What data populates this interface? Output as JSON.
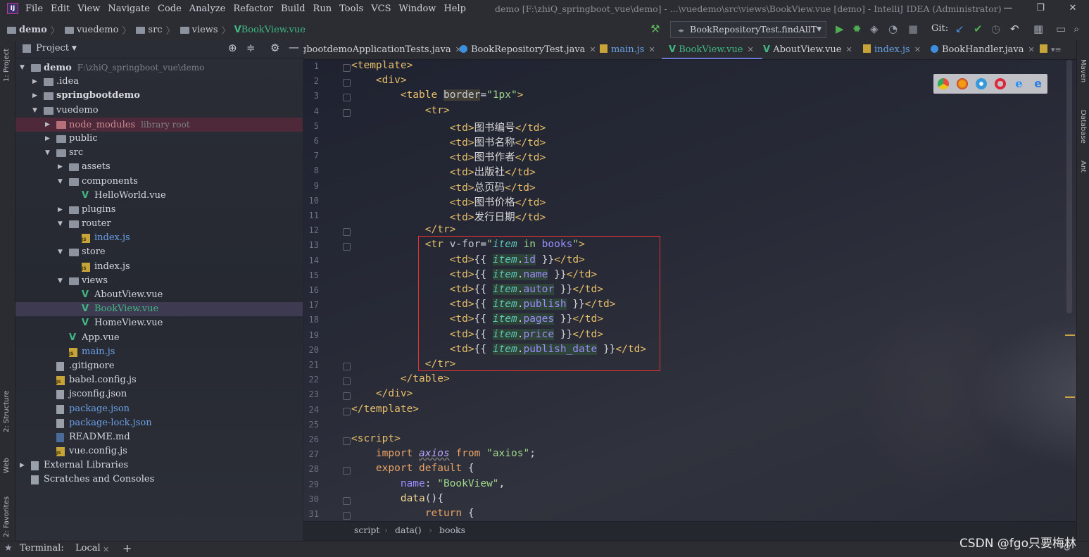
{
  "menubar": {
    "app_icon": "intellij-icon",
    "items": [
      "File",
      "Edit",
      "View",
      "Navigate",
      "Code",
      "Analyze",
      "Refactor",
      "Build",
      "Run",
      "Tools",
      "VCS",
      "Window",
      "Help"
    ],
    "title": "demo [F:\\zhiQ_springboot_vue\\demo] - ...\\vuedemo\\src\\views\\BookView.vue [demo] - IntelliJ IDEA (Administrator)",
    "minimize": "—",
    "restore": "❐",
    "close": "✕"
  },
  "breadcrumbs": [
    "demo",
    "vuedemo",
    "src",
    "views",
    "BookView.vue"
  ],
  "toolbar": {
    "run_config": "BookRepositoryTest.findAllT",
    "git_label": "Git:"
  },
  "project_panel": {
    "title": "Project",
    "tree": [
      {
        "label": "demo",
        "hint": "F:\\zhiQ_springboot_vue\\demo",
        "depth": 0,
        "icon": "folder-module",
        "open": true,
        "bold": true
      },
      {
        "label": ".idea",
        "depth": 1,
        "icon": "folder",
        "open": false
      },
      {
        "label": "springbootdemo",
        "depth": 1,
        "icon": "folder-module",
        "open": false,
        "bold": true
      },
      {
        "label": "vuedemo",
        "depth": 1,
        "icon": "folder-module",
        "open": true
      },
      {
        "label": "node_modules",
        "hint": "library root",
        "depth": 2,
        "icon": "folder-excluded",
        "open": false,
        "excluded": true
      },
      {
        "label": "public",
        "depth": 2,
        "icon": "folder",
        "open": false
      },
      {
        "label": "src",
        "depth": 2,
        "icon": "folder",
        "open": true
      },
      {
        "label": "assets",
        "depth": 3,
        "icon": "folder",
        "open": false
      },
      {
        "label": "components",
        "depth": 3,
        "icon": "folder",
        "open": true
      },
      {
        "label": "HelloWorld.vue",
        "depth": 4,
        "icon": "vue"
      },
      {
        "label": "plugins",
        "depth": 3,
        "icon": "folder",
        "open": false
      },
      {
        "label": "router",
        "depth": 3,
        "icon": "folder",
        "open": true
      },
      {
        "label": "index.js",
        "depth": 4,
        "icon": "js",
        "blue": true
      },
      {
        "label": "store",
        "depth": 3,
        "icon": "folder",
        "open": true
      },
      {
        "label": "index.js",
        "depth": 4,
        "icon": "js"
      },
      {
        "label": "views",
        "depth": 3,
        "icon": "folder",
        "open": true
      },
      {
        "label": "AboutView.vue",
        "depth": 4,
        "icon": "vue"
      },
      {
        "label": "BookView.vue",
        "depth": 4,
        "icon": "vue",
        "selected": true
      },
      {
        "label": "HomeView.vue",
        "depth": 4,
        "icon": "vue"
      },
      {
        "label": "App.vue",
        "depth": 3,
        "icon": "vue"
      },
      {
        "label": "main.js",
        "depth": 3,
        "icon": "js",
        "blue": true
      },
      {
        "label": ".gitignore",
        "depth": 2,
        "icon": "file"
      },
      {
        "label": "babel.config.js",
        "depth": 2,
        "icon": "js"
      },
      {
        "label": "jsconfig.json",
        "depth": 2,
        "icon": "file"
      },
      {
        "label": "package.json",
        "depth": 2,
        "icon": "file",
        "blue": true
      },
      {
        "label": "package-lock.json",
        "depth": 2,
        "icon": "file",
        "blue": true
      },
      {
        "label": "README.md",
        "depth": 2,
        "icon": "md"
      },
      {
        "label": "vue.config.js",
        "depth": 2,
        "icon": "js"
      },
      {
        "label": "External Libraries",
        "depth": 0,
        "icon": "library",
        "open": false
      },
      {
        "label": "Scratches and Consoles",
        "depth": 0,
        "icon": "scratch"
      }
    ]
  },
  "tabs": [
    {
      "label": "gbootdemoApplicationTests.java",
      "icon": "class"
    },
    {
      "label": "BookRepositoryTest.java",
      "icon": "class"
    },
    {
      "label": "main.js",
      "icon": "js"
    },
    {
      "label": "BookView.vue",
      "icon": "vue",
      "active": true
    },
    {
      "label": "AboutView.vue",
      "icon": "vue"
    },
    {
      "label": "index.js",
      "icon": "js"
    },
    {
      "label": "BookHandler.java",
      "icon": "class"
    }
  ],
  "editor": {
    "line_count": 31,
    "status_crumbs": [
      "script",
      "data()",
      "books"
    ]
  },
  "side_tools": {
    "left": [
      "1: Project",
      "2: Structure",
      "Web",
      "2: Favorites"
    ],
    "right": [
      "Maven",
      "Database",
      "Ant"
    ]
  },
  "bottom": {
    "terminal_label": "Terminal:",
    "local_tab": "Local",
    "add": "+"
  },
  "watermark": "CSDN @fgo只要梅林"
}
